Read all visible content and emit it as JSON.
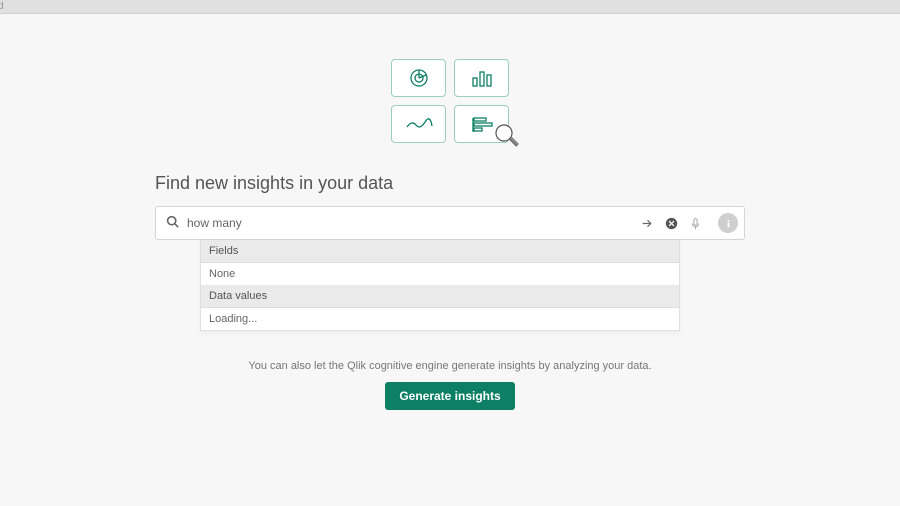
{
  "top_fragment": "d",
  "heading": "Find new insights in your data",
  "search": {
    "value": "how many "
  },
  "dropdown": {
    "fields_header": "Fields",
    "fields_value": "None",
    "datavalues_header": "Data values",
    "datavalues_value": "Loading..."
  },
  "hint": "You can also let the Qlik cognitive engine generate insights by analyzing your data.",
  "generate_label": "Generate insights"
}
